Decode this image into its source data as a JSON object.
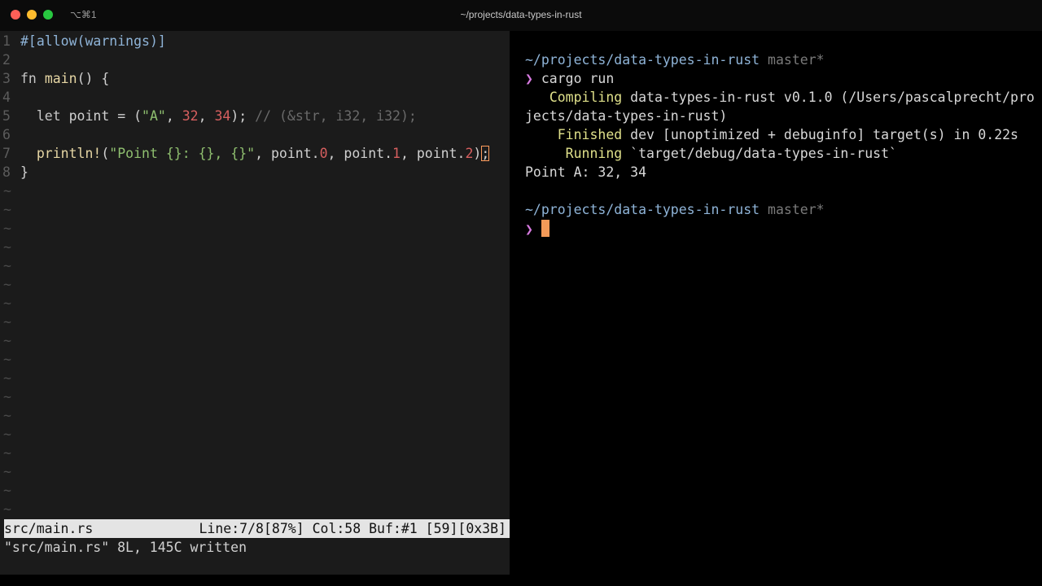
{
  "window": {
    "title": "~/projects/data-types-in-rust",
    "shortcut": "⌥⌘1"
  },
  "editor": {
    "line_numbers": [
      "1",
      "2",
      "3",
      "4",
      "5",
      "6",
      "7",
      "8"
    ],
    "tilde": "~",
    "lines": {
      "l1": "#[allow(warnings)]",
      "l3_kw": "fn",
      "l3_fn": "main",
      "l3_rest": "() {",
      "l5_kw": "let",
      "l5_a": " point = (",
      "l5_str": "\"A\"",
      "l5_b": ", ",
      "l5_n1": "32",
      "l5_c": ", ",
      "l5_n2": "34",
      "l5_d": "); ",
      "l5_comment": "// (&str, i32, i32);",
      "l7_mac": "println!",
      "l7_a": "(",
      "l7_str": "\"Point {}: {}, {}\"",
      "l7_b": ", point.",
      "l7_n0": "0",
      "l7_c": ", point.",
      "l7_n1": "1",
      "l7_d": ", point.",
      "l7_n2": "2",
      "l7_e": ")",
      "l7_cursor": ";",
      "l8": "}"
    },
    "status": {
      "filename": "src/main.rs",
      "position": "Line:7/8[87%] Col:58 Buf:#1 [59][0x3B]"
    },
    "message": "\"src/main.rs\" 8L, 145C written"
  },
  "terminal": {
    "path": "~/projects/data-types-in-rust",
    "branch": "master*",
    "prompt_symbol": "❯",
    "command": "cargo run",
    "compiling_kw": "Compiling",
    "compiling_rest": "data-types-in-rust v0.1.0 (/Users/pascalprecht/pro",
    "compiling_wrap": "jects/data-types-in-rust)",
    "finished_kw": "Finished",
    "finished_rest": "dev [unoptimized + debuginfo] target(s) in 0.22s",
    "running_kw": "Running",
    "running_rest": "`target/debug/data-types-in-rust`",
    "output": "Point A: 32, 34"
  },
  "colors": {
    "prompt": "#d77ae0",
    "cursor": "#f39a58",
    "path": "#8fb4d8",
    "cargo_status": "#dfe08a"
  }
}
